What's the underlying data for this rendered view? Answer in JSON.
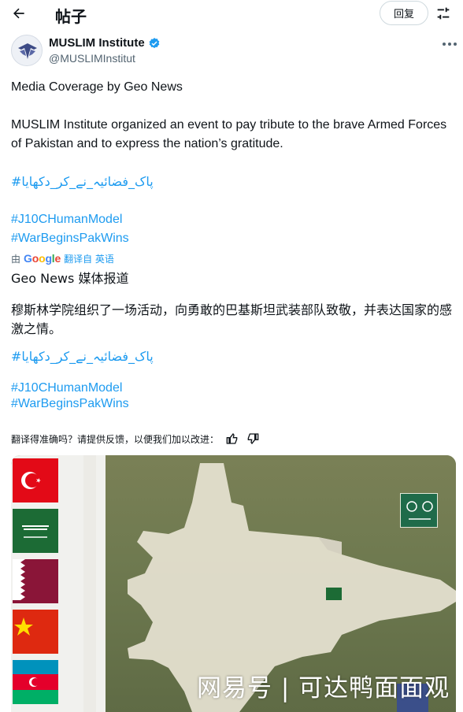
{
  "header": {
    "title": "帖子",
    "reply_label": "回复",
    "back_icon": "arrow-left-icon",
    "adjust_icon": "sliders-icon"
  },
  "author": {
    "name": "MUSLIM Institute",
    "handle": "@MUSLIMInstitut",
    "verified": true,
    "avatar_icon": "eagle-logo"
  },
  "post": {
    "line1": "Media Coverage by Geo News",
    "line2": "MUSLIM Institute organized an event to pay tribute to the brave Armed Forces of Pakistan and to express the nation’s gratitude.",
    "urdu_hashtag": "#پاک_فضائیہ_نے_کر_دکھایا",
    "hashtag1": "#J10CHumanModel",
    "hashtag2": "#WarBeginsPakWins"
  },
  "translation": {
    "by": "由",
    "google_letters": [
      "G",
      "o",
      "o",
      "g",
      "l",
      "e"
    ],
    "link": "翻译自 英语",
    "line1": "Geo News 媒体报道",
    "line2": "穆斯林学院组织了一场活动，向勇敢的巴基斯坦武装部队致敬，并表达国家的感激之情。",
    "urdu_hashtag": "#پاک_فضائیہ_نے_کر_دکھایا",
    "hashtag1": "#J10CHumanModel",
    "hashtag2": "#WarBeginsPakWins"
  },
  "feedback": {
    "question": "翻译得准确吗？请提供反馈，以便我们加以改进：",
    "thumbs_up_icon": "thumbs-up-icon",
    "thumbs_down_icon": "thumbs-down-icon"
  },
  "media": {
    "watermark": "网易号 | 可达鸭面面观",
    "colors": {
      "field": "#6f7a50",
      "badge": "#1f6b4a"
    }
  },
  "colors": {
    "link": "#1d9bf0",
    "text": "#0f1419",
    "secondary": "#536471",
    "verified": "#1d9bf0"
  }
}
